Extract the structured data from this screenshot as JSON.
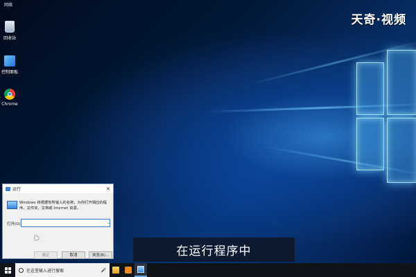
{
  "desktop": {
    "top_label": "网络",
    "brand": "天奇·视频",
    "icons": [
      {
        "name": "recycle-bin",
        "label": "回收站"
      },
      {
        "name": "control-panel",
        "label": "控制面板"
      },
      {
        "name": "chrome",
        "label": "Chrome"
      }
    ]
  },
  "run_dialog": {
    "title": "运行",
    "close_glyph": "×",
    "description": "Windows 将根据你所输入的名称，为你打开相应的程序、文件夹、文档或 Internet 资源。",
    "open_label": "打开(O):",
    "open_value": "",
    "buttons": {
      "ok": "确定",
      "cancel": "取消",
      "browse": "浏览(B)..."
    }
  },
  "subtitle": "在运行程序中",
  "taskbar": {
    "search_placeholder": "在这里输入进行搜索",
    "mic_glyph": "🎤"
  }
}
